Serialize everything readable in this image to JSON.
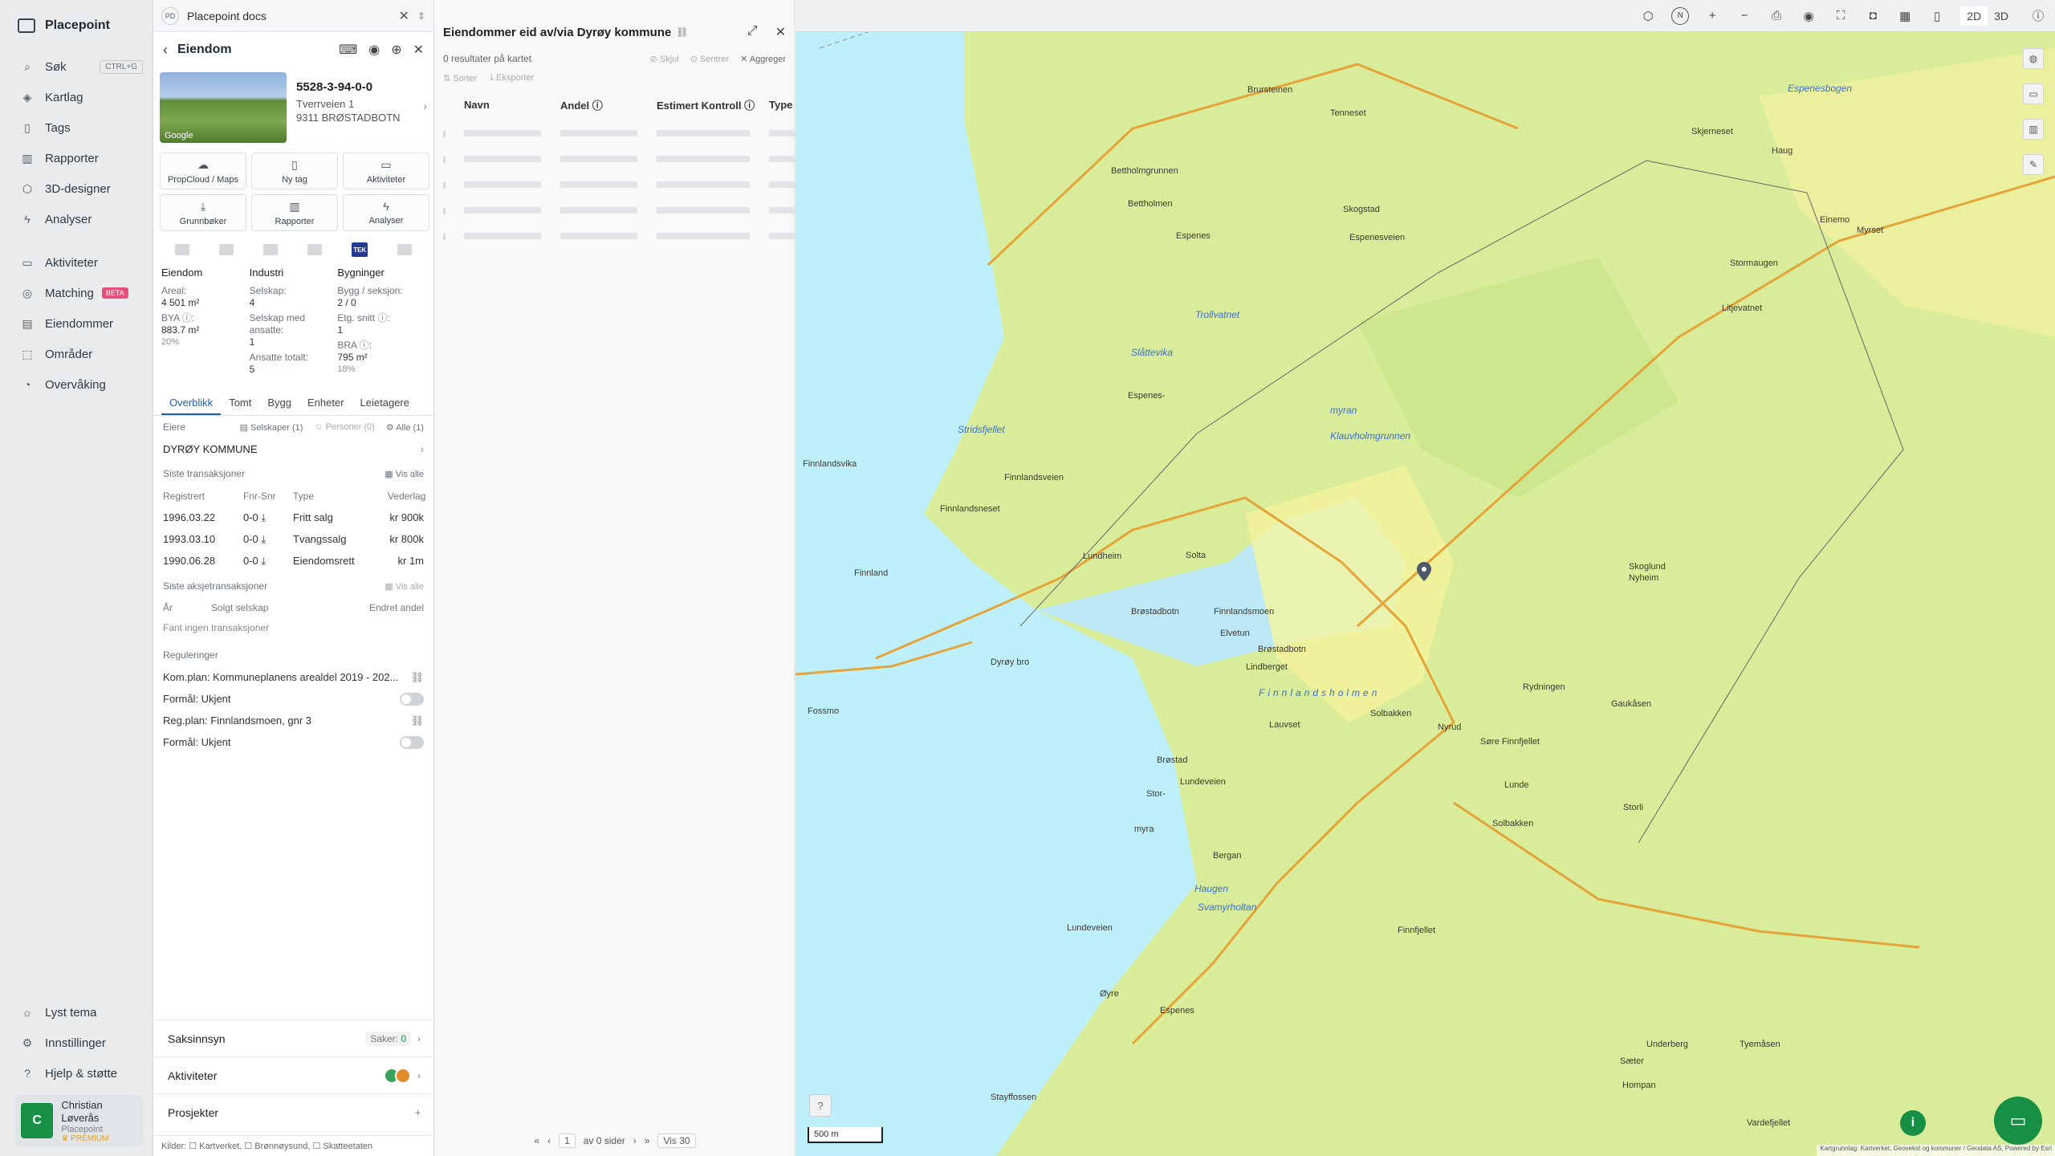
{
  "nav": {
    "brand": "Placepoint",
    "items": [
      {
        "label": "Søk",
        "icon": "search-icon",
        "shortcut": "CTRL+G"
      },
      {
        "label": "Kartlag",
        "icon": "layers-icon"
      },
      {
        "label": "Tags",
        "icon": "bookmark-icon"
      },
      {
        "label": "Rapporter",
        "icon": "bar-chart-icon"
      },
      {
        "label": "3D-designer",
        "icon": "cube-icon"
      },
      {
        "label": "Analyser",
        "icon": "bolt-icon"
      }
    ],
    "items2": [
      {
        "label": "Aktiviteter",
        "icon": "chat-icon"
      },
      {
        "label": "Matching",
        "icon": "target-icon",
        "badge": "BETA"
      },
      {
        "label": "Eiendommer",
        "icon": "building-icon"
      },
      {
        "label": "Områder",
        "icon": "area-icon"
      },
      {
        "label": "Overvåking",
        "icon": "monitor-icon"
      }
    ],
    "bottom": [
      {
        "label": "Lyst tema",
        "icon": "sun-icon"
      },
      {
        "label": "Innstillinger",
        "icon": "gear-icon"
      },
      {
        "label": "Hjelp & støtte",
        "icon": "help-icon"
      }
    ],
    "user": {
      "initial": "C",
      "name": "Christian Løverås",
      "org": "Placepoint",
      "plan": "PREMIUM"
    }
  },
  "panel1": {
    "tab_badge": "PD",
    "tab_title": "Placepoint docs",
    "title": "Eiendom",
    "property": {
      "id": "5528-3-94-0-0",
      "street": "Tverrveien 1",
      "city": "9311 BRØSTADBOTN",
      "thumb_label": "Google"
    },
    "buttons": [
      {
        "label": "PropCloud / Maps",
        "icon": "cloud-icon"
      },
      {
        "label": "Ny tag",
        "icon": "bookmark-icon"
      },
      {
        "label": "Aktiviteter",
        "icon": "chat-icon"
      },
      {
        "label": "Grunnbøker",
        "icon": "download-icon"
      },
      {
        "label": "Rapporter",
        "icon": "bar-chart-icon"
      },
      {
        "label": "Analyser",
        "icon": "bolt-icon"
      }
    ],
    "tek_label": "TEK",
    "stats": {
      "col1": {
        "title": "Eiendom",
        "areal_label": "Areal:",
        "areal_value": "4 501 m²",
        "bya_label": "BYA ⓘ:",
        "bya_value": "883.7 m²",
        "bya_pct": "20%"
      },
      "col2": {
        "title": "Industri",
        "selskap_label": "Selskap:",
        "selskap_value": "4",
        "ansatte_label": "Selskap med ansatte:",
        "ansatte_value": "1",
        "totalt_label": "Ansatte totalt:",
        "totalt_value": "5"
      },
      "col3": {
        "title": "Bygninger",
        "bygg_label": "Bygg / seksjon:",
        "bygg_value": "2 / 0",
        "etg_label": "Etg. snitt ⓘ:",
        "etg_value": "1",
        "bra_label": "BRA ⓘ:",
        "bra_value": "795 m²",
        "bra_pct": "18%"
      }
    },
    "tabs": [
      "Overblikk",
      "Tomt",
      "Bygg",
      "Enheter",
      "Leietagere"
    ],
    "owners": {
      "header": "Eiere",
      "filters": [
        "Selskaper (1)",
        "Personer (0)",
        "Alle (1)"
      ],
      "name": "DYRØY KOMMUNE"
    },
    "transactions": {
      "header": "Siste transaksjoner",
      "view_all": "Vis alle",
      "columns": [
        "Registrert",
        "Fnr-Snr",
        "Type",
        "Vederlag"
      ],
      "rows": [
        {
          "date": "1996.03.22",
          "fnr": "0-0 ⤓",
          "type": "Fritt salg",
          "price": "kr 900k"
        },
        {
          "date": "1993.03.10",
          "fnr": "0-0 ⤓",
          "type": "Tvangssalg",
          "price": "kr 800k"
        },
        {
          "date": "1990.06.28",
          "fnr": "0-0 ⤓",
          "type": "Eiendomsrett",
          "price": "kr 1m"
        }
      ]
    },
    "share_tx": {
      "header": "Siste aksjetransaksjoner",
      "view_all": "Vis alle",
      "columns": [
        "År",
        "Solgt selskap",
        "Endret andel"
      ],
      "empty": "Fant ingen transaksjoner"
    },
    "regulations": {
      "header": "Reguleringer",
      "rows": [
        {
          "label": "Kom.plan: Kommuneplanens arealdel 2019 - 202..."
        },
        {
          "label": "Formål: Ukjent"
        },
        {
          "label": "Reg.plan: Finnlandsmoen, gnr 3"
        },
        {
          "label": "Formål: Ukjent"
        }
      ]
    },
    "accordions": {
      "saksinnsyn": "Saksinnsyn",
      "saker_label": "Saker:",
      "saker_value": "0",
      "aktiviteter": "Aktiviteter",
      "prosjekter": "Prosjekter"
    },
    "sources": "Kilder: ☐ Kartverket, ☐ Brønnøysund, ☐ Skatteetaten"
  },
  "panel2": {
    "title": "Eiendommer eid av/via Dyrøy kommune",
    "results": "0 resultater på kartet",
    "actions": [
      "Skjul",
      "Sentrer",
      "Aggreger"
    ],
    "tools": [
      "Sorter",
      "Eksporter"
    ],
    "columns": [
      "Navn",
      "Andel ⓘ",
      "Estimert Kontroll ⓘ",
      "Type"
    ],
    "pager": {
      "page": "1",
      "of": "av 0 sider",
      "show": "Vis 30"
    }
  },
  "map": {
    "labels": [
      "Brursteinen",
      "Tenneset",
      "Espenesbogen",
      "Skjerneset",
      "Haug",
      "Bettholmgrunnen",
      "Bettholmen",
      "Espenes",
      "Skogstad",
      "Espenesveien",
      "Einemo",
      "Myrset",
      "Stormaugen",
      "Litjevatnet",
      "Trollvatnet",
      "Slåttevika",
      "Stridsfjellet",
      "Espenes-",
      "myran",
      "Klauvholmgrunnen",
      "Finnlandsvika",
      "Finnlandsveien",
      "Finnlandsneset",
      "Finnland",
      "Lundheim",
      "Solta",
      "Brøstadbotn",
      "Finnlandsmoen",
      "Elvetun",
      "Lindberget",
      "Brøstadbotn",
      "Finnlandsholmen",
      "Dyrøy bro",
      "Fossmo",
      "Solbakken",
      "Lauvset",
      "Nyrud",
      "Brøstad",
      "Lundeveien",
      "Stor-",
      "myra",
      "Bergan",
      "Haugen",
      "Svamyrholtan",
      "Lundeveien",
      "Øyre",
      "Espenes",
      "Finnfjellet",
      "Skoglund",
      "Nyheim",
      "Rydningen",
      "Gaukåsen",
      "Søre Finnfjellet",
      "Lunde",
      "Solbakken",
      "Storli",
      "Underberg",
      "Tyemåsen",
      "Sæter",
      "Hompan",
      "Vardefjellet",
      "Stayffossen"
    ],
    "scale_label": "500 m",
    "attribution": "Kartgrunnlag: Kartverket, Geovekst og kommuner / Geodata AS, Powered by Esri"
  },
  "topbar": {
    "north": "N",
    "view2d": "2D",
    "view3d": "3D"
  }
}
